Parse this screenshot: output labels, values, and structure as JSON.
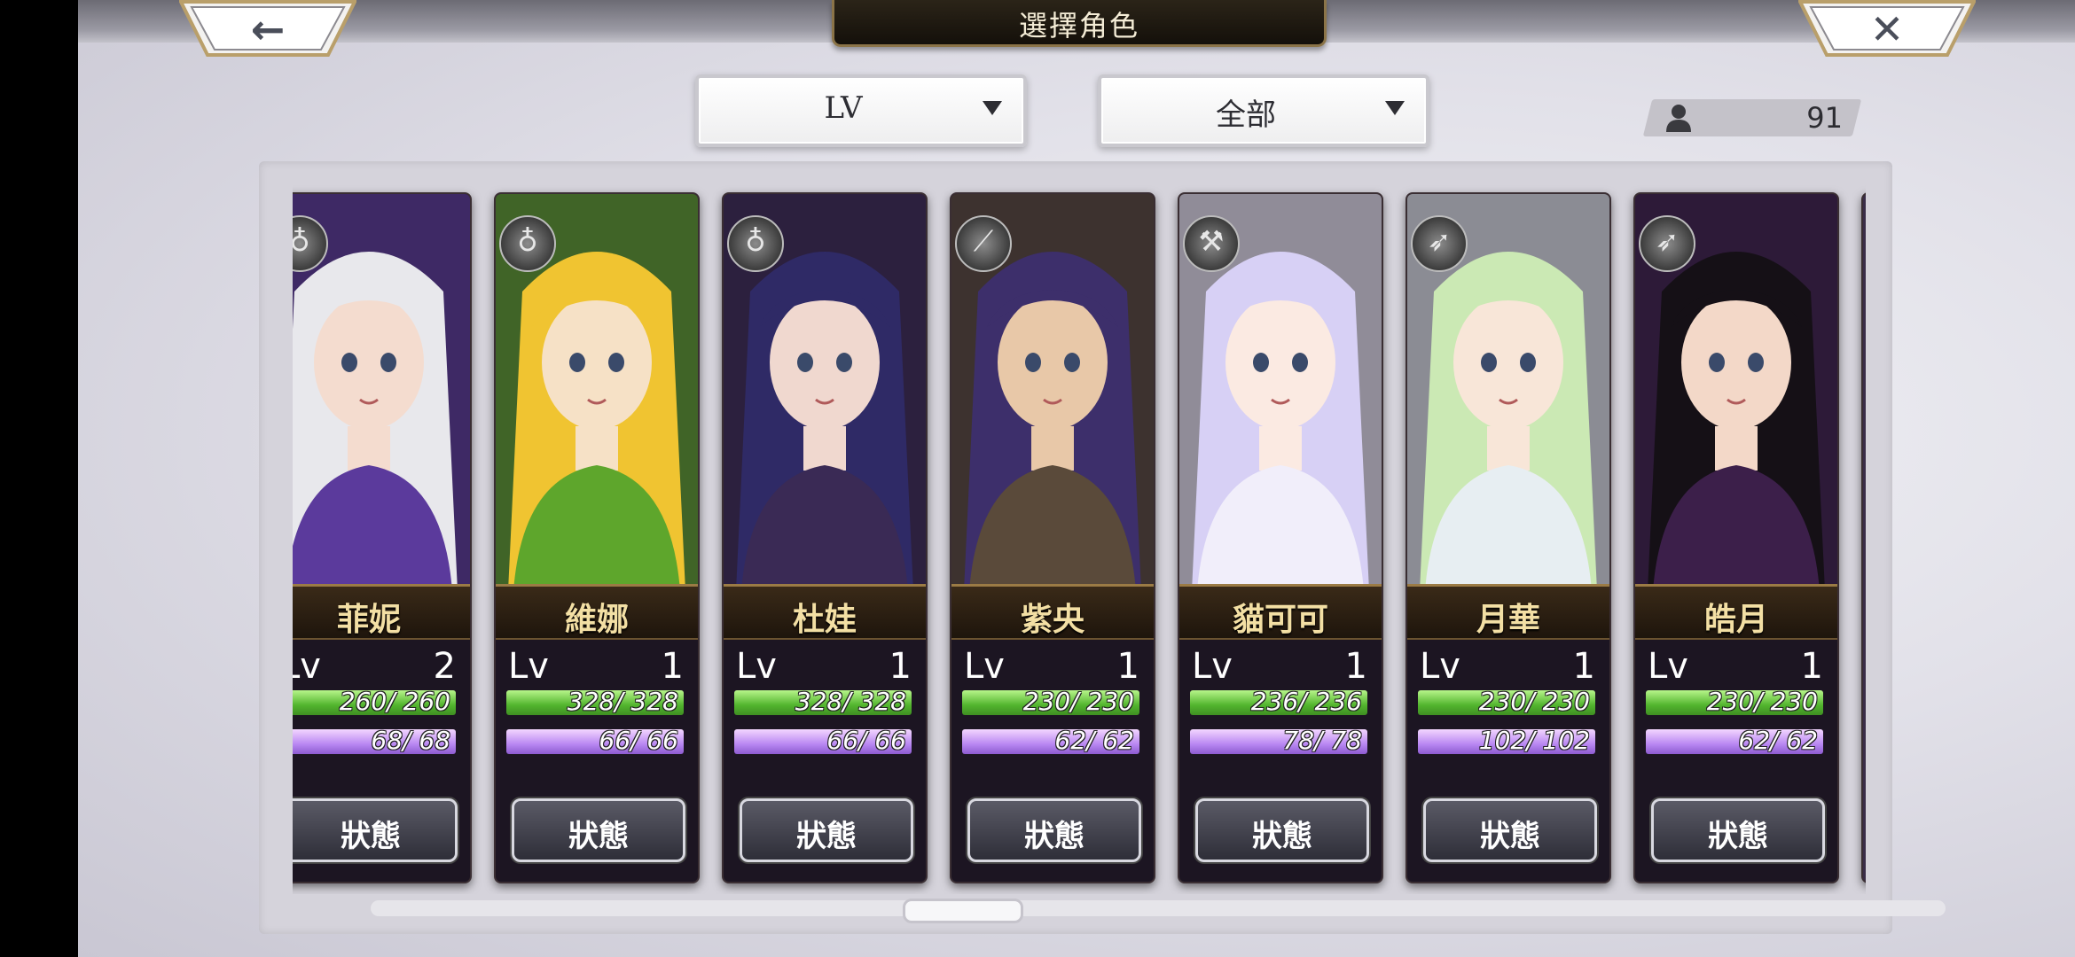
{
  "header": {
    "title": "選擇角色",
    "back_icon": "←",
    "close_icon": "✕"
  },
  "filters": {
    "sort_value": "LV",
    "filter_value": "全部"
  },
  "roster_count": "91",
  "level_label": "Lv",
  "status_label": "狀態",
  "characters": [
    {
      "name": "菲妮",
      "level": "2",
      "hp": "260/ 260",
      "mp": "68/ 68",
      "weapon": "staff",
      "weapon_glyph": "♁",
      "hair": "#e8e8ec",
      "skin": "#f4dccf",
      "outfit": "#5b3a9c"
    },
    {
      "name": "維娜",
      "level": "1",
      "hp": "328/ 328",
      "mp": "66/ 66",
      "weapon": "staff",
      "weapon_glyph": "♁",
      "hair": "#f0c431",
      "skin": "#f6e1c6",
      "outfit": "#5ea62c"
    },
    {
      "name": "杜娃",
      "level": "1",
      "hp": "328/ 328",
      "mp": "66/ 66",
      "weapon": "staff",
      "weapon_glyph": "♁",
      "hair": "#2f2a66",
      "skin": "#f0d8cf",
      "outfit": "#3a2a55"
    },
    {
      "name": "紫央",
      "level": "1",
      "hp": "230/ 230",
      "mp": "62/ 62",
      "weapon": "katana",
      "weapon_glyph": "⟋",
      "hair": "#3d2f6b",
      "skin": "#e8c8a8",
      "outfit": "#5a4a3a"
    },
    {
      "name": "貓可可",
      "level": "1",
      "hp": "236/ 236",
      "mp": "78/ 78",
      "weapon": "axe",
      "weapon_glyph": "⚒",
      "hair": "#d7d0f5",
      "skin": "#fbeae2",
      "outfit": "#f1eefa"
    },
    {
      "name": "月華",
      "level": "1",
      "hp": "230/ 230",
      "mp": "102/ 102",
      "weapon": "bow",
      "weapon_glyph": "➶",
      "hair": "#cbe9b4",
      "skin": "#f8e6d8",
      "outfit": "#e7eef2"
    },
    {
      "name": "皓月",
      "level": "1",
      "hp": "230/ 230",
      "mp": "62/ 62",
      "weapon": "bow",
      "weapon_glyph": "➶",
      "hair": "#151016",
      "skin": "#f3d8c8",
      "outfit": "#3c1f4a"
    }
  ]
}
